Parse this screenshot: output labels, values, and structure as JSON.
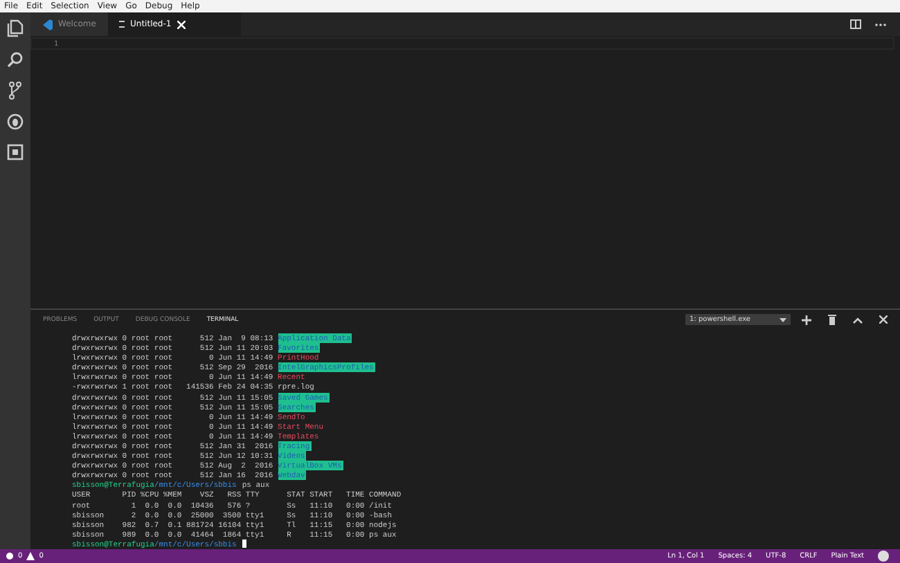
{
  "menu": [
    "File",
    "Edit",
    "Selection",
    "View",
    "Go",
    "Debug",
    "Help"
  ],
  "activity_bar": [
    {
      "kind": "files",
      "selected": false
    },
    {
      "kind": "search",
      "selected": false
    },
    {
      "kind": "git",
      "selected": false
    },
    {
      "kind": "debug",
      "selected": false
    },
    {
      "kind": "extensions",
      "selected": false
    }
  ],
  "tabs": [
    {
      "label": "Welcome",
      "kind": "welcome",
      "selected": false
    },
    {
      "label": "Untitled-1",
      "kind": "file",
      "selected": true
    }
  ],
  "editor": {
    "line_numbers": [
      "1"
    ]
  },
  "panel": {
    "tabs": [
      {
        "label": "PROBLEMS",
        "selected": false
      },
      {
        "label": "OUTPUT",
        "selected": false
      },
      {
        "label": "DEBUG CONSOLE",
        "selected": false
      },
      {
        "label": "TERMINAL",
        "selected": true
      }
    ],
    "terminal_select": "1: powershell.exe"
  },
  "terminal": [
    {
      "kind": "ls",
      "text": "drwxrwxrwx 0 root root      512 Jan  9 08:13 ",
      "name": "Application Data",
      "highlighted": true,
      "symlink": false
    },
    {
      "kind": "ls",
      "text": "drwxrwxrwx 0 root root      512 Jun 11 20:03 ",
      "name": "Favorites",
      "highlighted": true,
      "symlink": false
    },
    {
      "kind": "ls",
      "text": "lrwxrwxrwx 0 root root        0 Jun 11 14:49 ",
      "name": "PrintHood",
      "highlighted": false,
      "symlink": true
    },
    {
      "kind": "ls",
      "text": "drwxrwxrwx 0 root root      512 Sep 29  2016 ",
      "name": "IntelGraphicsProfiles",
      "highlighted": true,
      "symlink": false
    },
    {
      "kind": "ls",
      "text": "lrwxrwxrwx 0 root root        0 Jun 11 14:49 ",
      "name": "Recent",
      "highlighted": false,
      "symlink": true
    },
    {
      "kind": "ls",
      "text": "-rwxrwxrwx 1 root root   141536 Feb 24 04:35 ",
      "name": "rpre.log",
      "highlighted": false,
      "symlink": false
    },
    {
      "kind": "ls",
      "text": "drwxrwxrwx 0 root root      512 Jun 11 15:05 ",
      "name": "Saved Games",
      "highlighted": true,
      "symlink": false
    },
    {
      "kind": "ls",
      "text": "drwxrwxrwx 0 root root      512 Jun 11 15:05 ",
      "name": "Searches",
      "highlighted": true,
      "symlink": false
    },
    {
      "kind": "ls",
      "text": "lrwxrwxrwx 0 root root        0 Jun 11 14:49 ",
      "name": "SendTo",
      "highlighted": false,
      "symlink": true
    },
    {
      "kind": "ls",
      "text": "lrwxrwxrwx 0 root root        0 Jun 11 14:49 ",
      "name": "Start Menu",
      "highlighted": false,
      "symlink": true
    },
    {
      "kind": "ls",
      "text": "lrwxrwxrwx 0 root root        0 Jun 11 14:49 ",
      "name": "Templates",
      "highlighted": false,
      "symlink": true
    },
    {
      "kind": "ls",
      "text": "drwxrwxrwx 0 root root      512 Jan 31  2016 ",
      "name": "Tracing",
      "highlighted": true,
      "symlink": false
    },
    {
      "kind": "ls",
      "text": "drwxrwxrwx 0 root root      512 Jun 12 10:31 ",
      "name": "Videos",
      "highlighted": true,
      "symlink": false
    },
    {
      "kind": "ls",
      "text": "drwxrwxrwx 0 root root      512 Aug  2  2016 ",
      "name": "VirtualBox VMs",
      "highlighted": true,
      "symlink": false
    },
    {
      "kind": "ls",
      "text": "drwxrwxrwx 0 root root      512 Jan 16  2016 ",
      "name": "Webdav",
      "highlighted": true,
      "symlink": false
    },
    {
      "kind": "prompt",
      "user": "sbisson@Terrafugia",
      "path": "/mnt/c/Users/sbbis",
      "command": "ps aux"
    },
    {
      "kind": "plain",
      "text": "USER       PID %CPU %MEM    VSZ   RSS TTY      STAT START   TIME COMMAND"
    },
    {
      "kind": "plain",
      "text": "root         1  0.0  0.0  10436   576 ?        Ss   11:10   0:00 /init"
    },
    {
      "kind": "plain",
      "text": "sbisson      2  0.0  0.0  25000  3500 tty1     Ss   11:10   0:00 -bash"
    },
    {
      "kind": "plain",
      "text": "sbisson    982  0.7  0.1 881724 16104 tty1     Tl   11:15   0:00 nodejs"
    },
    {
      "kind": "plain",
      "text": "sbisson    989  0.0  0.0  41464  1864 tty1     R    11:15   0:00 ps aux"
    },
    {
      "kind": "prompt",
      "user": "sbisson@Terrafugia",
      "path": "/mnt/c/Users/sbbis",
      "cursor": true
    }
  ],
  "status_bar": {
    "errors": "0",
    "warnings": "0",
    "items": [
      "Ln 1, Col 1",
      "Spaces: 4",
      "UTF-8",
      "CRLF",
      "Plain Text"
    ]
  }
}
